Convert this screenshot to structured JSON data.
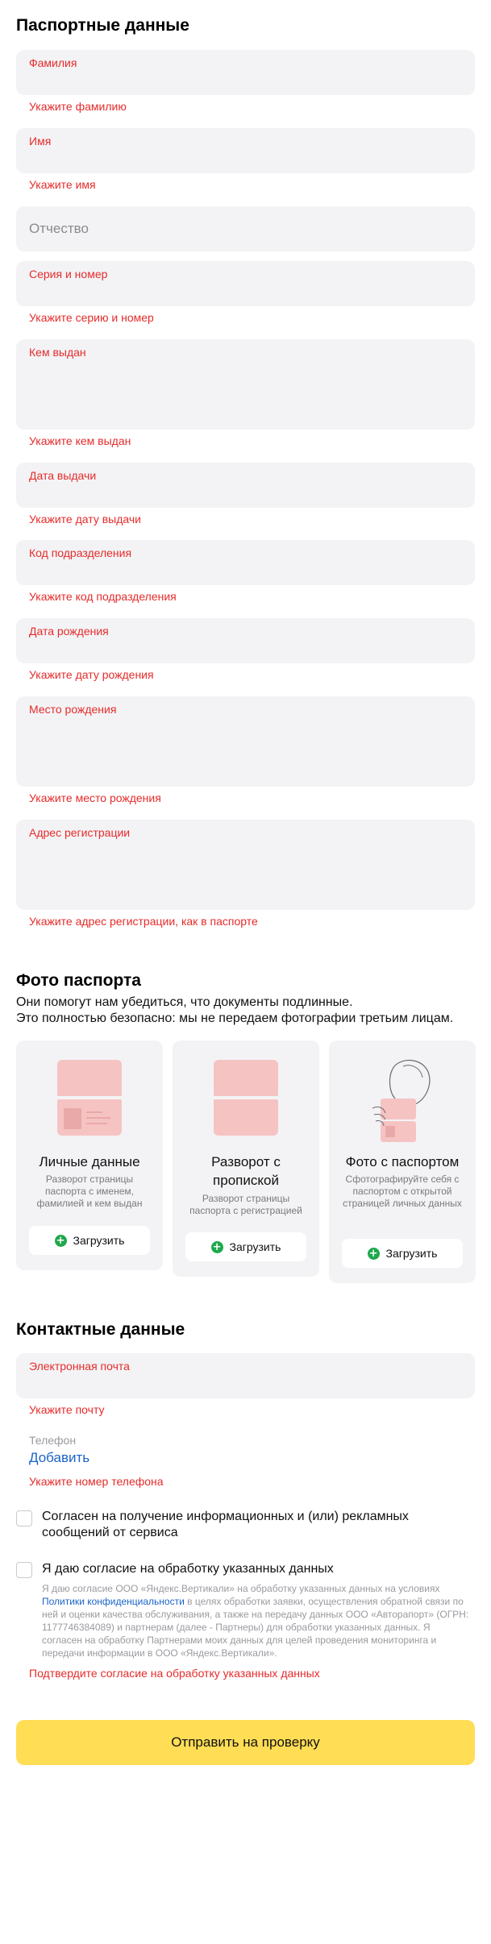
{
  "passport": {
    "title": "Паспортные данные",
    "surname": {
      "label": "Фамилия",
      "error": "Укажите фамилию"
    },
    "name": {
      "label": "Имя",
      "error": "Укажите имя"
    },
    "patronymic": {
      "placeholder": "Отчество"
    },
    "series": {
      "label": "Серия и номер",
      "error": "Укажите серию и номер"
    },
    "issued_by": {
      "label": "Кем выдан",
      "error": "Укажите кем выдан"
    },
    "issue_date": {
      "label": "Дата выдачи",
      "error": "Укажите дату выдачи"
    },
    "division_code": {
      "label": "Код подразделения",
      "error": "Укажите код подразделения"
    },
    "birth_date": {
      "label": "Дата рождения",
      "error": "Укажите дату рождения"
    },
    "birth_place": {
      "label": "Место рождения",
      "error": "Укажите место рождения"
    },
    "reg_address": {
      "label": "Адрес регистрации",
      "error": "Укажите адрес регистрации, как в паспорте"
    }
  },
  "photos": {
    "title": "Фото паспорта",
    "subtitle_1": "Они помогут нам убедиться, что документы подлинные.",
    "subtitle_2": "Это полностью безопасно: мы не передаем фотографии третьим лицам.",
    "cards": [
      {
        "title": "Личные данные",
        "desc": "Разворот страницы паспорта с именем, фамилией и кем выдан",
        "upload": "Загрузить",
        "icon": "passport-personal-icon"
      },
      {
        "title_1": "Разворот с",
        "title_2": "пропиской",
        "desc": "Разворот страницы паспорта с регистрацией",
        "upload": "Загрузить",
        "icon": "passport-registration-icon"
      },
      {
        "title": "Фото с паспортом",
        "desc": "Сфотографируйте себя с паспортом с открытой страницей личных данных",
        "upload": "Загрузить",
        "icon": "selfie-passport-icon"
      }
    ]
  },
  "contacts": {
    "title": "Контактные данные",
    "email": {
      "label": "Электронная почта",
      "error": "Укажите почту"
    },
    "phone": {
      "label": "Телефон",
      "add": "Добавить",
      "error": "Укажите номер телефона"
    },
    "consent_ads": "Согласен на получение информационных и (или) рекламных сообщений от сервиса",
    "consent_data": "Я даю согласие на обработку указанных данных",
    "legal_1": "Я даю согласие ООО «Яндекс.Вертикали» на обработку указанных данных на условиях",
    "legal_link": "Политики конфиденциальности",
    "legal_2": "в целях обработки заявки, осуществления обратной связи по ней и оценки качества обслуживания, а также на передачу данных ООО «Авторапорт» (ОГРН: 1177746384089) и партнерам (далее - Партнеры) для обработки указанных данных. Я согласен на обработку Партнерами моих данных для целей проведения мониторинга и передачи информации в ООО «Яндекс.Вертикали».",
    "consent_error": "Подтвердите согласие на обработку указанных данных"
  },
  "submit": "Отправить на проверку",
  "colors": {
    "error": "#e62b2b",
    "field_bg": "#f3f3f5",
    "submit_bg": "#ffdd55",
    "link": "#1a63c9",
    "upload_plus": "#1fa84c"
  }
}
